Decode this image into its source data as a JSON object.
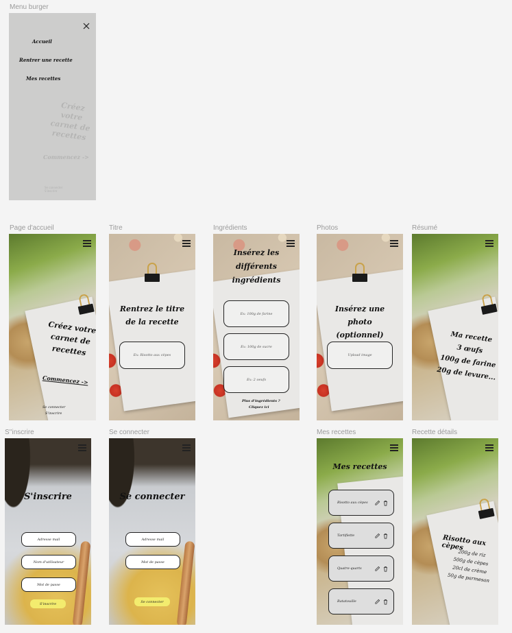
{
  "frames": {
    "menu_burger": {
      "label": "Menu burger",
      "items": [
        "Accueil",
        "Rentrer une recette",
        "Mes recettes"
      ],
      "ghost_title": "Créez votre carnet de recettes",
      "ghost_link": "Commencez ->",
      "ghost_footer": "Se connecter S'inscrire"
    },
    "accueil": {
      "label": "Page d'accueil",
      "title_lines": [
        "Créez votre",
        "carnet de",
        "recettes"
      ],
      "cta": "Commencez ->",
      "footer_1": "Se connecter",
      "footer_2": "S'inscrire"
    },
    "titre": {
      "label": "Titre",
      "title_lines": [
        "Rentrez le titre",
        "de la recette"
      ],
      "placeholder": "Ex: Risotto aux cèpes"
    },
    "ingredients": {
      "label": "Ingrédients",
      "title_lines": [
        "Insérez les",
        "différents",
        "ingrédients"
      ],
      "fields": [
        "Ex: 100g de farine",
        "Ex: 100g de sucre",
        "Ex: 2 oeufs"
      ],
      "more_1": "Plus d'ingrédients ?",
      "more_2": "Cliquez ici"
    },
    "photos": {
      "label": "Photos",
      "title_lines": [
        "Insérez une photo",
        "(optionnel)"
      ],
      "upload": "Upload image"
    },
    "resume": {
      "label": "Résumé",
      "lines": [
        "Ma recette",
        "3 œufs",
        "100g de farine",
        "20g de levure..."
      ]
    },
    "inscrire": {
      "label": "S''inscrire",
      "title": "S'inscrire",
      "fields": [
        "Adresse mail",
        "Nom d'utilisateur",
        "Mot de passe"
      ],
      "button": "S'inscrire"
    },
    "connecter": {
      "label": "Se connecter",
      "title": "Se connecter",
      "fields": [
        "Adresse mail",
        "Mot de passe"
      ],
      "button": "Se connecter"
    },
    "mes_recettes": {
      "label": "Mes recettes",
      "title": "Mes recettes",
      "recipes": [
        "Risotto aux cèpes",
        "Tartiflette",
        "Quatre-quarts",
        "Ratatouille"
      ]
    },
    "recette_details": {
      "label": "Recette détails",
      "title": "Risotto aux cèpes",
      "lines": [
        "200g de riz",
        "500g de cèpes",
        "20cl de crème",
        "50g de parmesan"
      ]
    }
  },
  "icons": {
    "menu": "hamburger-icon",
    "close": "close-icon",
    "edit": "pencil-icon",
    "delete": "trash-icon"
  },
  "colors": {
    "canvas": "#f4f4f4",
    "paper": "#e9e8e6",
    "button_yellow": "#f3ec6e",
    "label_grey": "#9a9a9a"
  }
}
